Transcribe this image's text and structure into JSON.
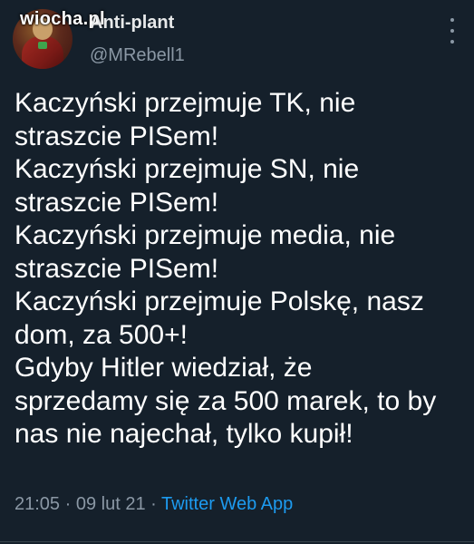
{
  "watermark": "wiocha.pl",
  "author": {
    "display_name": "Anti-plant",
    "handle": "@MRebell1"
  },
  "tweet": {
    "lines": [
      "Kaczyński przejmuje TK, nie",
      "straszcie PISem!",
      "Kaczyński przejmuje SN, nie",
      "straszcie PISem!",
      "Kaczyński przejmuje media, nie",
      "straszcie PISem!",
      "Kaczyński przejmuje Polskę, nasz",
      "dom, za 500+!",
      "Gdyby Hitler wiedział, że",
      "sprzedamy się za 500 marek, to by",
      "nas nie najechał, tylko kupił!"
    ]
  },
  "meta": {
    "time": "21:05",
    "separator": " · ",
    "date": "09 lut 21",
    "source": "Twitter Web App"
  },
  "colors": {
    "background": "#15202b",
    "text": "#ffffff",
    "muted": "#8b98a5",
    "link": "#1d9bf0"
  },
  "icons": {
    "more": "more-vertical-icon"
  }
}
